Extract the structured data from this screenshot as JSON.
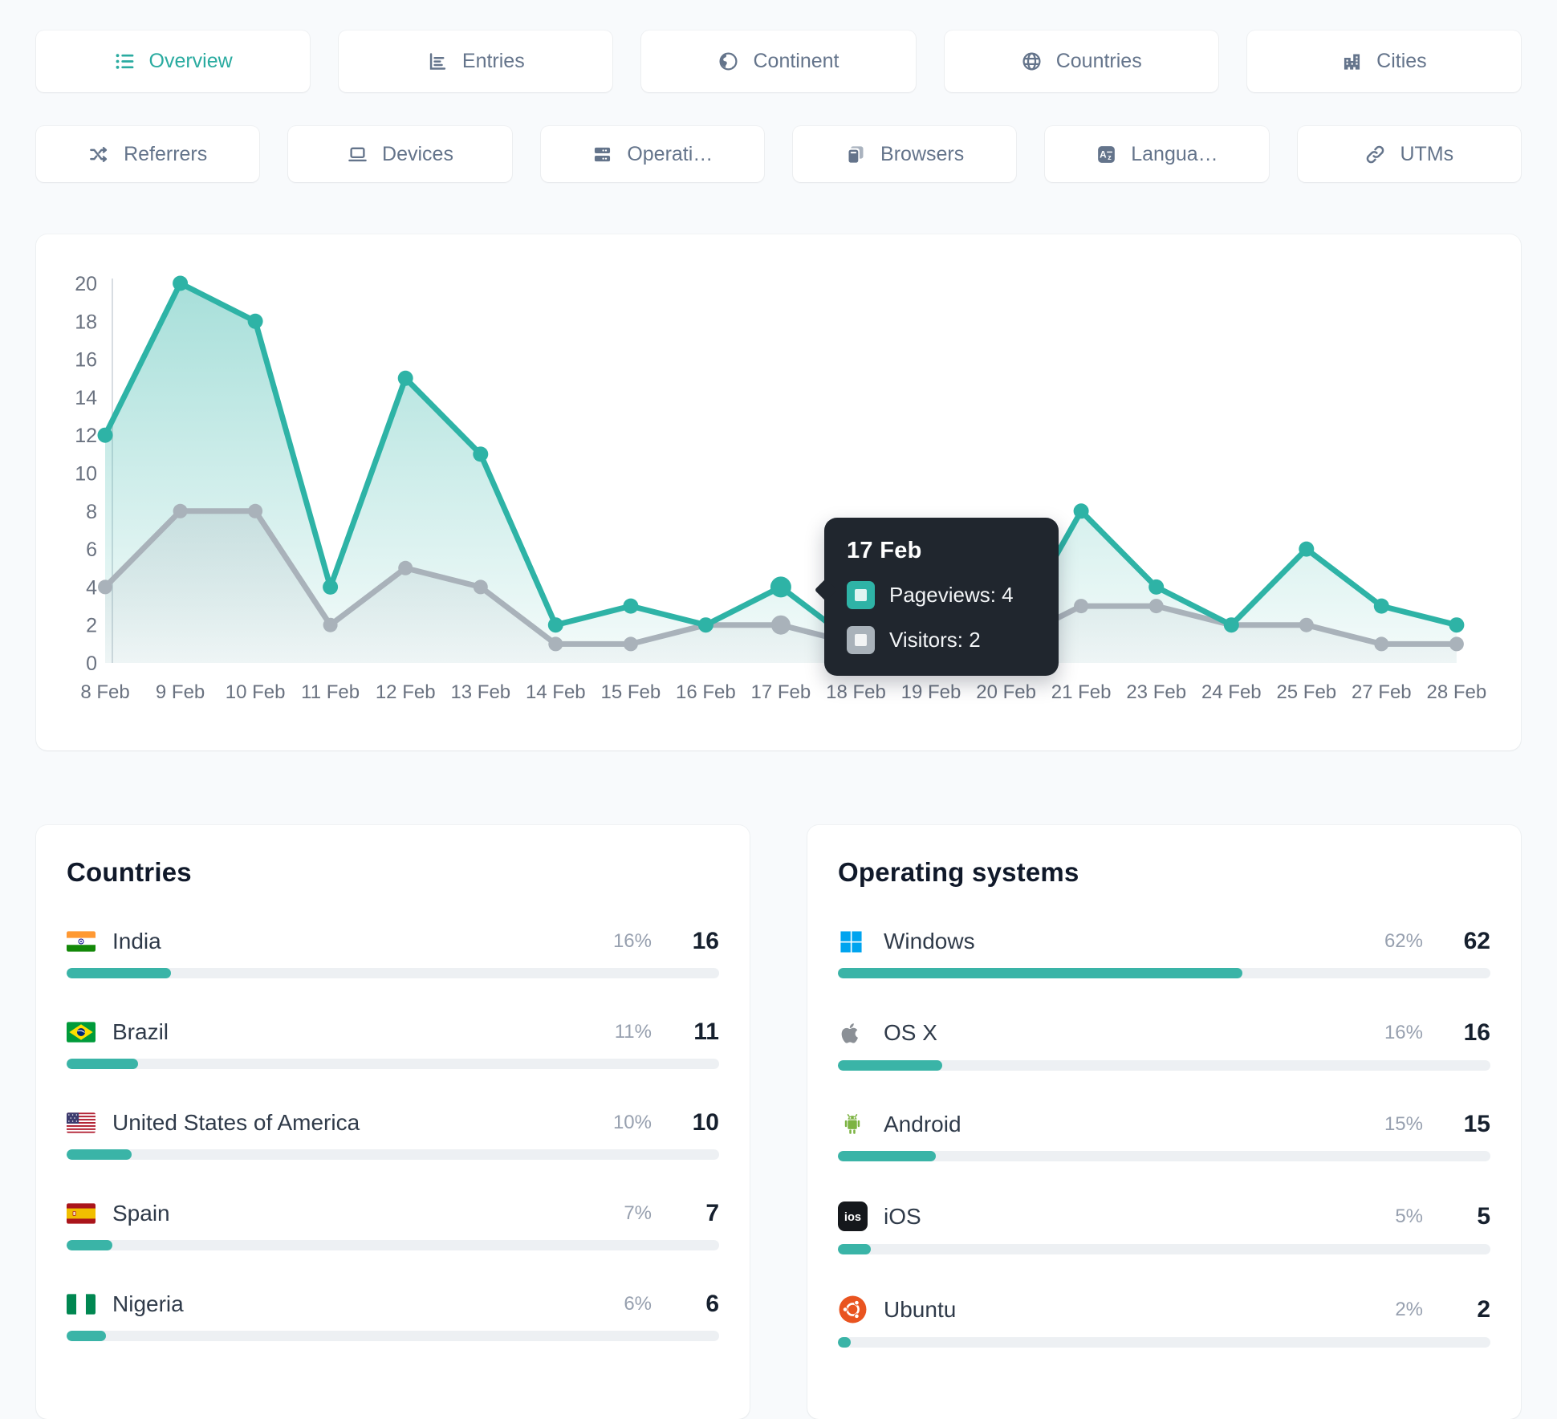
{
  "tabs_row1": [
    {
      "id": "overview",
      "label": "Overview",
      "icon": "list",
      "active": true
    },
    {
      "id": "entries",
      "label": "Entries",
      "icon": "entries",
      "active": false
    },
    {
      "id": "continent",
      "label": "Continent",
      "icon": "earth",
      "active": false
    },
    {
      "id": "countries",
      "label": "Countries",
      "icon": "globe",
      "active": false
    },
    {
      "id": "cities",
      "label": "Cities",
      "icon": "city",
      "active": false
    }
  ],
  "tabs_row2": [
    {
      "id": "referrers",
      "label": "Referrers",
      "icon": "shuffle",
      "active": false
    },
    {
      "id": "devices",
      "label": "Devices",
      "icon": "laptop",
      "active": false
    },
    {
      "id": "operating-systems",
      "label": "Operati…",
      "icon": "server",
      "active": false
    },
    {
      "id": "browsers",
      "label": "Browsers",
      "icon": "browser",
      "active": false
    },
    {
      "id": "languages",
      "label": "Langua…",
      "icon": "translate",
      "active": false
    },
    {
      "id": "utms",
      "label": "UTMs",
      "icon": "link",
      "active": false
    }
  ],
  "chart_data": {
    "type": "line",
    "title": "",
    "xlabel": "",
    "ylabel": "",
    "x": [
      "8 Feb",
      "9 Feb",
      "10 Feb",
      "11 Feb",
      "12 Feb",
      "13 Feb",
      "14 Feb",
      "15 Feb",
      "16 Feb",
      "17 Feb",
      "18 Feb",
      "19 Feb",
      "20 Feb",
      "21 Feb",
      "23 Feb",
      "24 Feb",
      "25 Feb",
      "27 Feb",
      "28 Feb"
    ],
    "series": [
      {
        "name": "Pageviews",
        "color": "#2eb3a6",
        "values": [
          12,
          20,
          18,
          4,
          15,
          11,
          2,
          3,
          2,
          4,
          1,
          1,
          1,
          8,
          4,
          2,
          6,
          3,
          2
        ]
      },
      {
        "name": "Visitors",
        "color": "#a9b2ba",
        "values": [
          4,
          8,
          8,
          2,
          5,
          4,
          1,
          1,
          2,
          2,
          1,
          1,
          1,
          3,
          3,
          2,
          2,
          1,
          1
        ]
      }
    ],
    "ylim": [
      0,
      20
    ],
    "yticks": [
      0,
      2,
      4,
      6,
      8,
      10,
      12,
      14,
      16,
      18,
      20
    ],
    "grid": false,
    "legend_position": "none",
    "tooltip": {
      "date": "17 Feb",
      "index": 9,
      "items": [
        {
          "label": "Pageviews",
          "value": "4"
        },
        {
          "label": "Visitors",
          "value": "2"
        }
      ]
    }
  },
  "panels": [
    {
      "title": "Countries",
      "rows": [
        {
          "icon": "flag-in",
          "label": "India",
          "pct": 16,
          "pct_label": "16%",
          "count": "16"
        },
        {
          "icon": "flag-br",
          "label": "Brazil",
          "pct": 11,
          "pct_label": "11%",
          "count": "11"
        },
        {
          "icon": "flag-us",
          "label": "United States of America",
          "pct": 10,
          "pct_label": "10%",
          "count": "10"
        },
        {
          "icon": "flag-es",
          "label": "Spain",
          "pct": 7,
          "pct_label": "7%",
          "count": "7"
        },
        {
          "icon": "flag-ng",
          "label": "Nigeria",
          "pct": 6,
          "pct_label": "6%",
          "count": "6"
        }
      ]
    },
    {
      "title": "Operating systems",
      "rows": [
        {
          "icon": "windows",
          "label": "Windows",
          "pct": 62,
          "pct_label": "62%",
          "count": "62"
        },
        {
          "icon": "apple",
          "label": "OS X",
          "pct": 16,
          "pct_label": "16%",
          "count": "16"
        },
        {
          "icon": "android",
          "label": "Android",
          "pct": 15,
          "pct_label": "15%",
          "count": "15"
        },
        {
          "icon": "ios",
          "label": "iOS",
          "pct": 5,
          "pct_label": "5%",
          "count": "5"
        },
        {
          "icon": "ubuntu",
          "label": "Ubuntu",
          "pct": 2,
          "pct_label": "2%",
          "count": "2"
        }
      ]
    }
  ],
  "colors": {
    "accent_teal": "#2eb3a6",
    "line_gray": "#a9b2ba",
    "bar_fill": "#3ab4a7",
    "bar_track": "#edf0f3",
    "tooltip_bg": "#20262e",
    "tab_text": "#64748b",
    "tab_active_text": "#2aaba0",
    "axis_text": "#6a7280",
    "page_bg": "#f8fafc",
    "card_bg": "#ffffff"
  }
}
